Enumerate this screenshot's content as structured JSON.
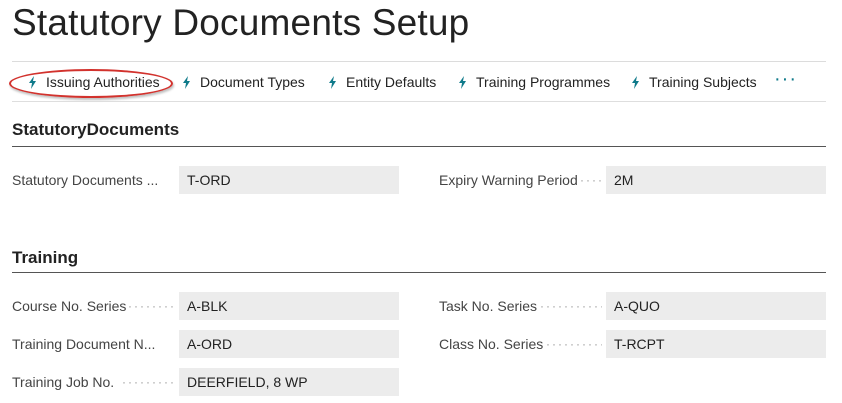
{
  "page": {
    "title": "Statutory Documents Setup"
  },
  "actions": [
    {
      "label": "Issuing Authorities",
      "icon": "lightning-icon"
    },
    {
      "label": "Document Types",
      "icon": "lightning-icon"
    },
    {
      "label": "Entity Defaults",
      "icon": "lightning-icon"
    },
    {
      "label": "Training Programmes",
      "icon": "lightning-icon"
    },
    {
      "label": "Training Subjects",
      "icon": "lightning-icon"
    }
  ],
  "more_label": "···",
  "colors": {
    "accent": "#0f7a8a",
    "highlight_ring": "#d2322d",
    "field_bg": "#ececec"
  },
  "sections": {
    "statutory": {
      "title": "StatutoryDocuments",
      "fields": {
        "doc_nos": {
          "label": "Statutory Documents ...",
          "value": "T-ORD"
        },
        "expiry": {
          "label": "Expiry Warning Period",
          "value": "2M"
        }
      }
    },
    "training": {
      "title": "Training",
      "fields": {
        "course": {
          "label": "Course No. Series",
          "value": "A-BLK"
        },
        "task": {
          "label": "Task No. Series",
          "value": "A-QUO"
        },
        "doc": {
          "label": "Training Document N...",
          "value": "A-ORD"
        },
        "class": {
          "label": "Class No. Series",
          "value": "T-RCPT"
        },
        "job": {
          "label": "Training Job No.",
          "value": "DEERFIELD, 8 WP"
        }
      }
    }
  }
}
